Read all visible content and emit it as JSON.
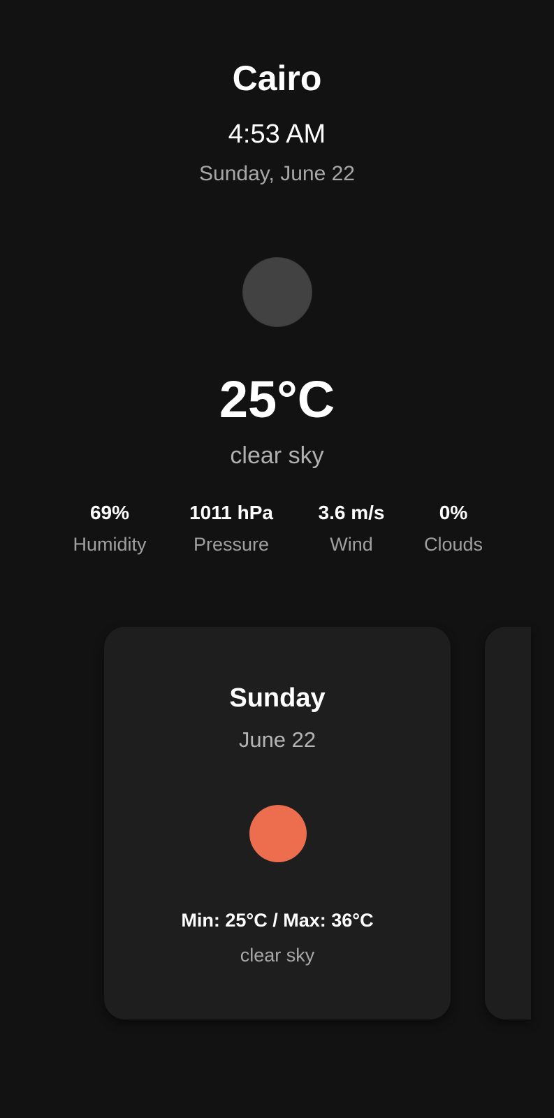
{
  "location": {
    "city": "Cairo",
    "time": "4:53 AM",
    "date": "Sunday, June 22"
  },
  "current": {
    "icon": "weather-icon",
    "temperature": "25°C",
    "condition": "clear sky",
    "stats": [
      {
        "value": "69%",
        "label": "Humidity"
      },
      {
        "value": "1011 hPa",
        "label": "Pressure"
      },
      {
        "value": "3.6 m/s",
        "label": "Wind"
      },
      {
        "value": "0%",
        "label": "Clouds"
      }
    ]
  },
  "forecast": {
    "cards": [
      {
        "day": "Sunday",
        "date": "June 22",
        "icon": "sun-icon",
        "min_max": "Min: 25°C / Max: 36°C",
        "condition": "clear sky"
      }
    ]
  },
  "colors": {
    "background": "#121212",
    "card": "#1e1e1e",
    "sun": "#ec6e4f",
    "icon_placeholder": "#424242"
  }
}
